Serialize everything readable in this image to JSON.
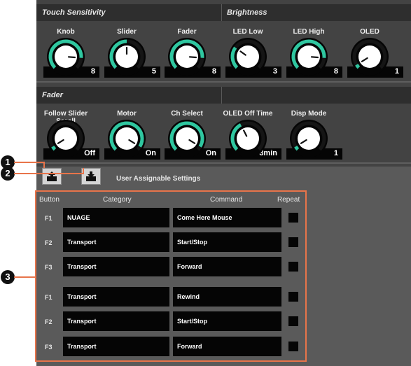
{
  "sections": {
    "touch_sensitivity": "Touch Sensitivity",
    "brightness": "Brightness",
    "fader": "Fader"
  },
  "row1_knobs": [
    {
      "label": "Knob",
      "value": "8",
      "level": 0.85
    },
    {
      "label": "Slider",
      "value": "5",
      "level": 0.5
    },
    {
      "label": "Fader",
      "value": "8",
      "level": 0.85
    },
    {
      "label": "LED Low",
      "value": "3",
      "level": 0.3
    },
    {
      "label": "LED High",
      "value": "8",
      "level": 0.85
    },
    {
      "label": "OLED",
      "value": "1",
      "level": 0.05
    }
  ],
  "row2_knobs": [
    {
      "label": "Follow Slider Scroll",
      "value": "Off",
      "level": 0.05
    },
    {
      "label": "Motor",
      "value": "On",
      "level": 0.95
    },
    {
      "label": "Ch Select",
      "value": "On",
      "level": 0.95
    },
    {
      "label": "OLED Off Time",
      "value": "3min",
      "level": 0.4
    },
    {
      "label": "Disp Mode",
      "value": "1",
      "level": 0.05
    }
  ],
  "assign": {
    "title": "User Assignable Settings",
    "columns": {
      "button": "Button",
      "category": "Category",
      "command": "Command",
      "repeat": "Repeat"
    },
    "rows": [
      {
        "button": "F1",
        "category": "NUAGE",
        "command": "Come Here Mouse"
      },
      {
        "button": "F2",
        "category": "Transport",
        "command": "Start/Stop"
      },
      {
        "button": "F3",
        "category": "Transport",
        "command": "Forward"
      },
      {
        "button": "F1",
        "category": "Transport",
        "command": "Rewind"
      },
      {
        "button": "F2",
        "category": "Transport",
        "command": "Start/Stop"
      },
      {
        "button": "F3",
        "category": "Transport",
        "command": "Forward"
      }
    ]
  },
  "callouts": [
    "1",
    "2",
    "3"
  ],
  "icons": {
    "export": "export-icon",
    "import": "import-icon"
  },
  "colors": {
    "accent": "#2fc7a0",
    "highlight": "#e8744a",
    "panel": "#434343"
  }
}
